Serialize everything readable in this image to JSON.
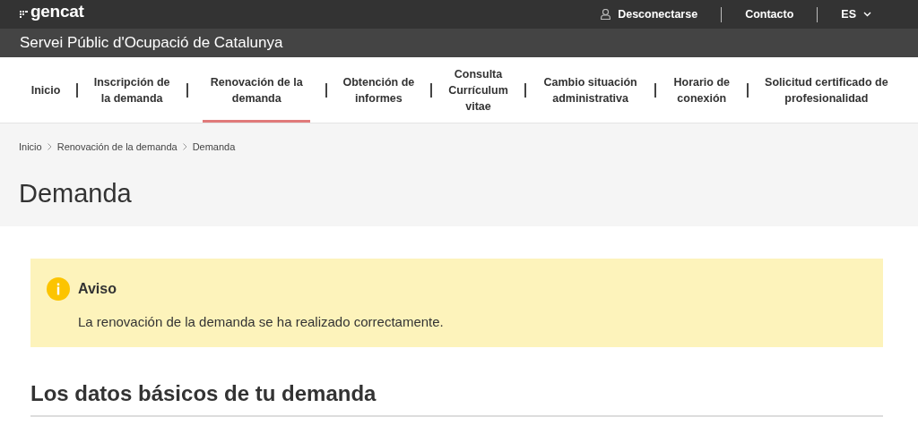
{
  "topbar": {
    "logo": "gencat",
    "links": [
      {
        "label": "Desconectarse",
        "kind": "user"
      },
      {
        "label": "Contacto",
        "kind": "plain"
      },
      {
        "label": "ES",
        "kind": "dropdown"
      }
    ]
  },
  "site_title": "Servei Públic d'Ocupació de Catalunya",
  "nav": [
    {
      "label": "Inicio",
      "selected": false
    },
    {
      "label": "Inscripción de la demanda",
      "selected": false
    },
    {
      "label": "Renovación de la demanda",
      "selected": true
    },
    {
      "label": "Obtención de informes",
      "selected": false
    },
    {
      "label": "Consulta Currículum vitae",
      "selected": false
    },
    {
      "label": "Cambio situación administrativa",
      "selected": false
    },
    {
      "label": "Horario de conexión",
      "selected": false
    },
    {
      "label": "Solicitud certificado de profesionalidad",
      "selected": false
    }
  ],
  "breadcrumb": [
    "Inicio",
    "Renovación de la demanda",
    "Demanda"
  ],
  "page_title": "Demanda",
  "notice": {
    "title": "Aviso",
    "message": "La renovación de la demanda se ha realizado correctamente."
  },
  "section_title": "Los datos básicos de tu demanda"
}
